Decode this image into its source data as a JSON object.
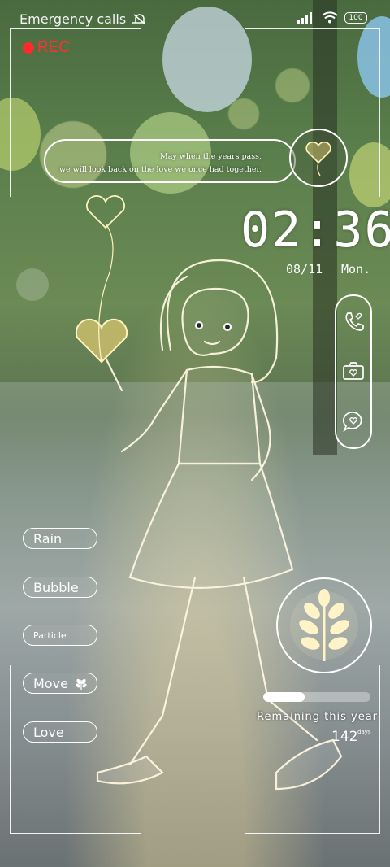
{
  "status_bar": {
    "carrier_text": "Emergency calls",
    "battery": "100",
    "icons": [
      "mute-icon",
      "signal-icon",
      "wifi-icon",
      "battery-icon"
    ]
  },
  "rec": {
    "label": "REC"
  },
  "quote": {
    "line1": "May when the years pass,",
    "line2": "we will look back on the love we once had together."
  },
  "clock": {
    "time": "02:36",
    "date": "08/11",
    "weekday": "Mon."
  },
  "dock": {
    "icons": [
      "phone-icon",
      "camera-icon",
      "message-heart-icon"
    ]
  },
  "effects": {
    "buttons": [
      {
        "label": "Rain"
      },
      {
        "label": "Bubble"
      },
      {
        "label": "Particle"
      },
      {
        "label": "Move"
      },
      {
        "label": "Love"
      }
    ]
  },
  "year_progress": {
    "label": "Remaining this year",
    "days": "142",
    "days_unit": "days",
    "fraction_elapsed": 0.39
  },
  "colors": {
    "accent": "#ffffff",
    "rec": "#ff2a2a"
  }
}
